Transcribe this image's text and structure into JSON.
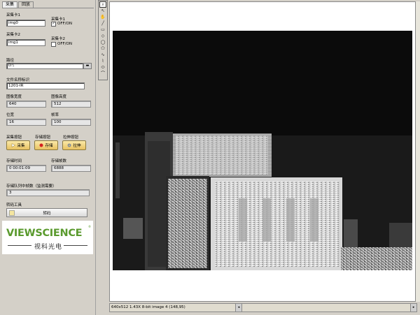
{
  "tabs": [
    "采集",
    "回放"
  ],
  "acquire": {
    "card1_label": "采集卡1",
    "card1_value": "img0",
    "card2_label": "采集卡2",
    "card2_value": "img1",
    "chk1_label": "采集卡1",
    "chk1_text": "OFF/ON",
    "chk1_state": "✓",
    "chk2_label": "采集卡2",
    "chk2_text": "OFF/ON",
    "path_label": "路径",
    "path_value": "D:\\",
    "filename_label": "文件名称标识",
    "filename_value": "1201-IR",
    "width_label": "图像宽度",
    "width_value": "640",
    "height_label": "图像高度",
    "height_value": "512",
    "depth_label": "位宽",
    "depth_value": "16",
    "fps_label": "帧率",
    "fps_value": "100",
    "acq_btn_label": "采集按钮",
    "store_btn_label": "存储按钮",
    "pull_btn_label": "拉伸按钮",
    "btn_acq": "采集",
    "btn_store": "存储",
    "btn_pull": "拉伸",
    "store_time_label": "存储时间",
    "store_time_value": "0 00:01:09",
    "store_frames_label": "存储帧数",
    "store_frames_value": "6888",
    "queue_label": "存储队列中帧数（监测需要）",
    "queue_value": "3",
    "tool_label": "转码工具",
    "convert_btn": "转码"
  },
  "logo": {
    "main": "VIEWSCIENCE",
    "sub": "视科光电",
    "reg": "®"
  },
  "status": "640x512 1.43X 8-bit image 4    (148,95)",
  "colors": {
    "logo_green": "#5a9a2e",
    "button_gold": "#e8c262"
  }
}
